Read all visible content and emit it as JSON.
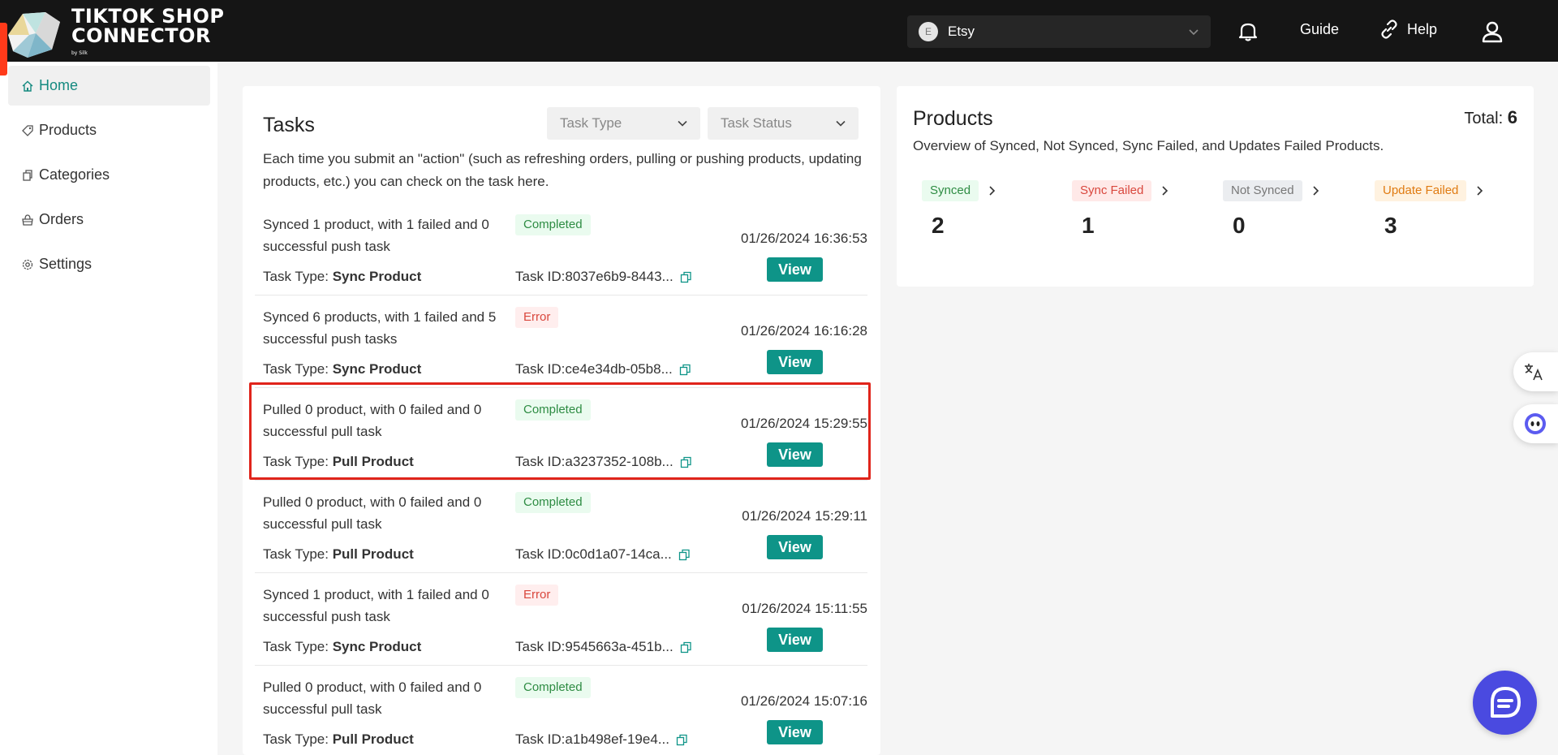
{
  "header": {
    "logo_lines": [
      "TIKTOK SHOP",
      "CONNECTOR"
    ],
    "logo_by": "by Silk",
    "store": {
      "avatar_letter": "E",
      "name": "Etsy"
    },
    "guide_label": "Guide",
    "help_label": "Help"
  },
  "sidebar": {
    "items": [
      {
        "label": "Home",
        "icon": "home-icon",
        "active": true
      },
      {
        "label": "Products",
        "icon": "tag-icon",
        "active": false
      },
      {
        "label": "Categories",
        "icon": "categories-icon",
        "active": false
      },
      {
        "label": "Orders",
        "icon": "orders-icon",
        "active": false
      },
      {
        "label": "Settings",
        "icon": "gear-icon",
        "active": false
      }
    ]
  },
  "tasks": {
    "title": "Tasks",
    "filter_type_placeholder": "Task Type",
    "filter_status_placeholder": "Task Status",
    "description": "Each time you submit an \"action\" (such as refreshing orders, pulling or pushing products, updating products, etc.) you can check on the task here.",
    "type_prefix": "Task Type: ",
    "id_prefix": "Task ID: ",
    "view_label": "View",
    "rows": [
      {
        "summary": "Synced 1 product, with 1 failed and 0 successful push task",
        "status": "Completed",
        "task_type": "Sync Product",
        "task_id": "8037e6b9-8443...",
        "time": "01/26/2024 16:36:53"
      },
      {
        "summary": "Synced 6 products, with 1 failed and 5 successful push tasks",
        "status": "Error",
        "task_type": "Sync Product",
        "task_id": "ce4e34db-05b8...",
        "time": "01/26/2024 16:16:28"
      },
      {
        "summary": "Pulled 0 product, with 0 failed and 0 successful pull task",
        "status": "Completed",
        "task_type": "Pull Product",
        "task_id": "a3237352-108b...",
        "time": "01/26/2024 15:29:55"
      },
      {
        "summary": "Pulled 0 product, with 0 failed and 0 successful pull task",
        "status": "Completed",
        "task_type": "Pull Product",
        "task_id": "0c0d1a07-14ca...",
        "time": "01/26/2024 15:29:11"
      },
      {
        "summary": "Synced 1 product, with 1 failed and 0 successful push task",
        "status": "Error",
        "task_type": "Sync Product",
        "task_id": "9545663a-451b...",
        "time": "01/26/2024 15:11:55"
      },
      {
        "summary": "Pulled 0 product, with 0 failed and 0 successful pull task",
        "status": "Completed",
        "task_type": "Pull Product",
        "task_id": "a1b498ef-19e4...",
        "time": "01/26/2024 15:07:16"
      }
    ]
  },
  "products": {
    "title": "Products",
    "total_label": "Total:",
    "total_value": "6",
    "description": "Overview of Synced, Not Synced, Sync Failed, and Updates Failed Products.",
    "stats": [
      {
        "label": "Synced",
        "value": "2",
        "bg": "#eafbef",
        "fg": "#2e8c43"
      },
      {
        "label": "Sync Failed",
        "value": "1",
        "bg": "#ffe9e8",
        "fg": "#d9473d"
      },
      {
        "label": "Not Synced",
        "value": "0",
        "bg": "#ebedf0",
        "fg": "#777777"
      },
      {
        "label": "Update Failed",
        "value": "3",
        "bg": "#fff2e0",
        "fg": "#e07b12"
      }
    ]
  },
  "colors": {
    "header_bg": "#151515",
    "accent": "#0e9488",
    "highlight": "#e0241b",
    "chat": "#4a4ae0"
  }
}
